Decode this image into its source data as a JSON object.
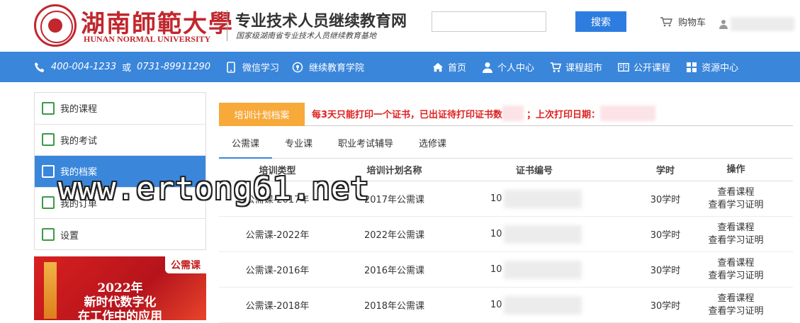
{
  "header": {
    "university_cn": "湖南師範大學",
    "university_en": "HUNAN NORMAL UNIVERSITY",
    "site_name": "专业技术人员继续教育网",
    "site_sub": "国家级湖南省专业技术人员继续教育基地",
    "search_button": "搜索",
    "search_placeholder": "",
    "cart_label": "购物车"
  },
  "nav": {
    "phone1": "400-004-1233",
    "or": "或",
    "phone2": "0731-89911290",
    "wechat": "微信学习",
    "college": "继续教育学院",
    "items": [
      {
        "label": "首页",
        "icon": "home-icon"
      },
      {
        "label": "个人中心",
        "icon": "person-icon"
      },
      {
        "label": "课程超市",
        "icon": "cart-icon"
      },
      {
        "label": "公开课程",
        "icon": "book-icon"
      },
      {
        "label": "资源中心",
        "icon": "grid-icon"
      }
    ]
  },
  "sidebar": {
    "items": [
      {
        "label": "我的课程",
        "active": false
      },
      {
        "label": "我的考试",
        "active": false
      },
      {
        "label": "我的档案",
        "active": true
      },
      {
        "label": "我的订单",
        "active": false
      },
      {
        "label": "设置",
        "active": false
      }
    ]
  },
  "banner": {
    "tag": "公需课",
    "line1": "2022年",
    "line2": "新时代数字化",
    "line3": "在工作中的应用"
  },
  "main": {
    "archive_tab": "培训计划档案",
    "notice_part1": "每3天只能打印一个证书，已出证待打印证书数",
    "notice_part2": "；上次打印日期：",
    "tabs": [
      "公需课",
      "专业课",
      "职业考试辅导",
      "选修课"
    ],
    "active_tab": 0,
    "columns": [
      "培训类型",
      "培训计划名称",
      "证书编号",
      "学时",
      "操作"
    ],
    "rows": [
      {
        "type": "公需课-2017年",
        "plan": "2017年公需课",
        "cert_prefix": "10",
        "hours": "30学时",
        "op1": "查看课程",
        "op2": "查看学习证明"
      },
      {
        "type": "公需课-2022年",
        "plan": "2022年公需课",
        "cert_prefix": "10",
        "hours": "30学时",
        "op1": "查看课程",
        "op2": "查看学习证明"
      },
      {
        "type": "公需课-2016年",
        "plan": "2016年公需课",
        "cert_prefix": "10",
        "hours": "30学时",
        "op1": "查看课程",
        "op2": "查看学习证明"
      },
      {
        "type": "公需课-2018年",
        "plan": "2018年公需课",
        "cert_prefix": "10",
        "hours": "30学时",
        "op1": "查看课程",
        "op2": "查看学习证明"
      }
    ]
  },
  "watermark": "www.ertong61.net",
  "colors": {
    "brand_red": "#c1272d",
    "nav_blue": "#3a86db",
    "tab_orange": "#f7a93a",
    "notice_red": "#e02020"
  }
}
